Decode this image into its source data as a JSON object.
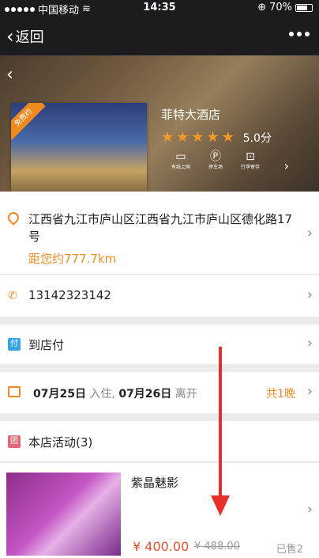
{
  "status_bar": {
    "carrier": "中国移动",
    "time": "14:35",
    "battery": "70%",
    "battery_level": 0.7
  },
  "nav": {
    "back_label": "返回"
  },
  "hotel": {
    "name": "菲特大酒店",
    "badge": "免费约",
    "rating": "5.0分",
    "stars": 5,
    "amenities": [
      {
        "icon": "monitor-icon",
        "glyph": "▭",
        "label": "有线上网"
      },
      {
        "icon": "parking-icon",
        "glyph": "Ⓟ",
        "label": "停车场"
      },
      {
        "icon": "luggage-icon",
        "glyph": "⊡",
        "label": "行李寄存"
      }
    ]
  },
  "address": {
    "text": "江西省九江市庐山区江西省九江市庐山区德化路17号",
    "distance": "距您约777.7km"
  },
  "phone": {
    "number": "13142323142"
  },
  "payment": {
    "icon_text": "付",
    "label": "到店付"
  },
  "stay": {
    "check_in_date": "07月25日",
    "check_in_label": "入住,",
    "check_out_date": "07月26日",
    "check_out_label": "离开",
    "nights": "共1晚"
  },
  "activities": {
    "icon_text": "团",
    "label": "本店活动(3)"
  },
  "room": {
    "name": "紫晶魅影",
    "price": "¥ 400.00",
    "original_price": "¥ 488.00",
    "sold": "已售2"
  },
  "colors": {
    "accent": "#f08a1f",
    "price": "#e8502c",
    "annotation_arrow": "#e8302a",
    "pay_blue": "#3aa3e3"
  }
}
